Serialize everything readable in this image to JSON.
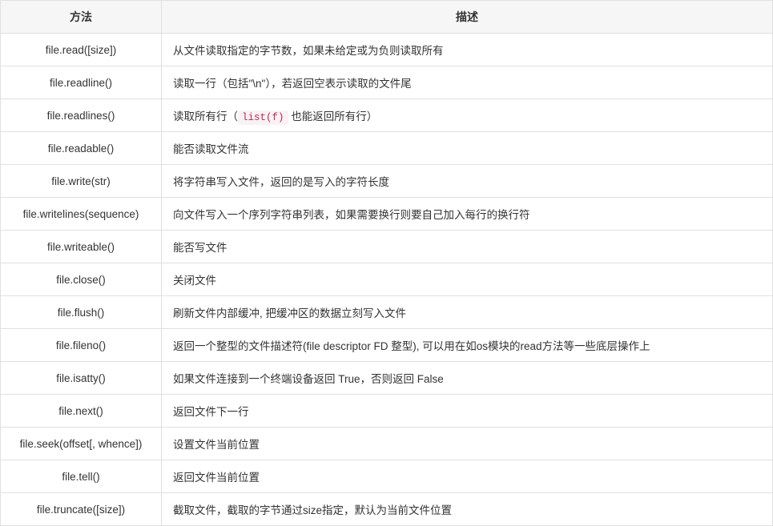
{
  "headers": {
    "method": "方法",
    "description": "描述"
  },
  "rows": [
    {
      "method": "file.read([size])",
      "desc": "从文件读取指定的字节数，如果未给定或为负则读取所有"
    },
    {
      "method": "file.readline()",
      "desc": "读取一行（包括\"\\n\"），若返回空表示读取的文件尾"
    },
    {
      "method": "file.readlines()",
      "desc_pre": "读取所有行（",
      "code": "list(f)",
      "desc_post": " 也能返回所有行）"
    },
    {
      "method": "file.readable()",
      "desc": "能否读取文件流"
    },
    {
      "method": "file.write(str)",
      "desc": "将字符串写入文件，返回的是写入的字符长度"
    },
    {
      "method": "file.writelines(sequence)",
      "desc": "向文件写入一个序列字符串列表，如果需要换行则要自己加入每行的换行符"
    },
    {
      "method": "file.writeable()",
      "desc": "能否写文件"
    },
    {
      "method": "file.close()",
      "desc": "关闭文件"
    },
    {
      "method": "file.flush()",
      "desc": "刷新文件内部缓冲, 把缓冲区的数据立刻写入文件"
    },
    {
      "method": "file.fileno()",
      "desc": "返回一个整型的文件描述符(file descriptor FD 整型), 可以用在如os模块的read方法等一些底层操作上"
    },
    {
      "method": "file.isatty()",
      "desc": "如果文件连接到一个终端设备返回 True，否则返回 False"
    },
    {
      "method": "file.next()",
      "desc": "返回文件下一行"
    },
    {
      "method": "file.seek(offset[, whence])",
      "desc": "设置文件当前位置"
    },
    {
      "method": "file.tell()",
      "desc": "返回文件当前位置"
    },
    {
      "method": "file.truncate([size])",
      "desc": "截取文件，截取的字节通过size指定，默认为当前文件位置"
    }
  ]
}
